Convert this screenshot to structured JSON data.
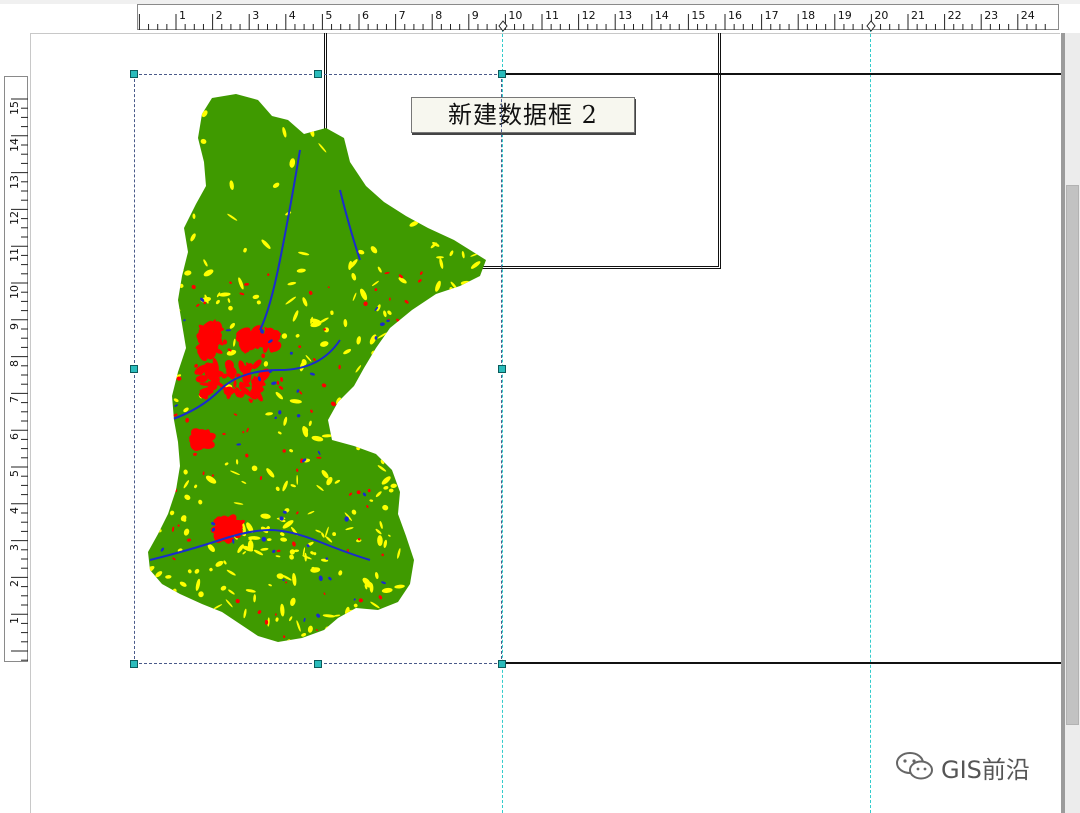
{
  "top_ruler": {
    "labels": [
      "1",
      "2",
      "3",
      "4",
      "5",
      "6",
      "7",
      "8",
      "9",
      "10",
      "11",
      "12",
      "13",
      "14",
      "15",
      "16",
      "17",
      "18",
      "19",
      "20",
      "21",
      "22",
      "23",
      "24"
    ]
  },
  "left_ruler": {
    "labels": [
      "15",
      "14",
      "13",
      "12",
      "11",
      "10",
      "9",
      "8",
      "7",
      "6",
      "5",
      "4",
      "3",
      "2",
      "1"
    ]
  },
  "data_frame_2": {
    "label": "新建数据框 2"
  },
  "map": {
    "legend_colors": {
      "forest": "#3f9a00",
      "cropland": "#ffff00",
      "urban": "#ff0000",
      "water": "#1a2ccc"
    }
  },
  "colors": {
    "selection_handle": "#2bbcbc",
    "guide": "#33cccc"
  },
  "watermark": {
    "text": "GIS前沿",
    "icon": "wechat-icon"
  }
}
